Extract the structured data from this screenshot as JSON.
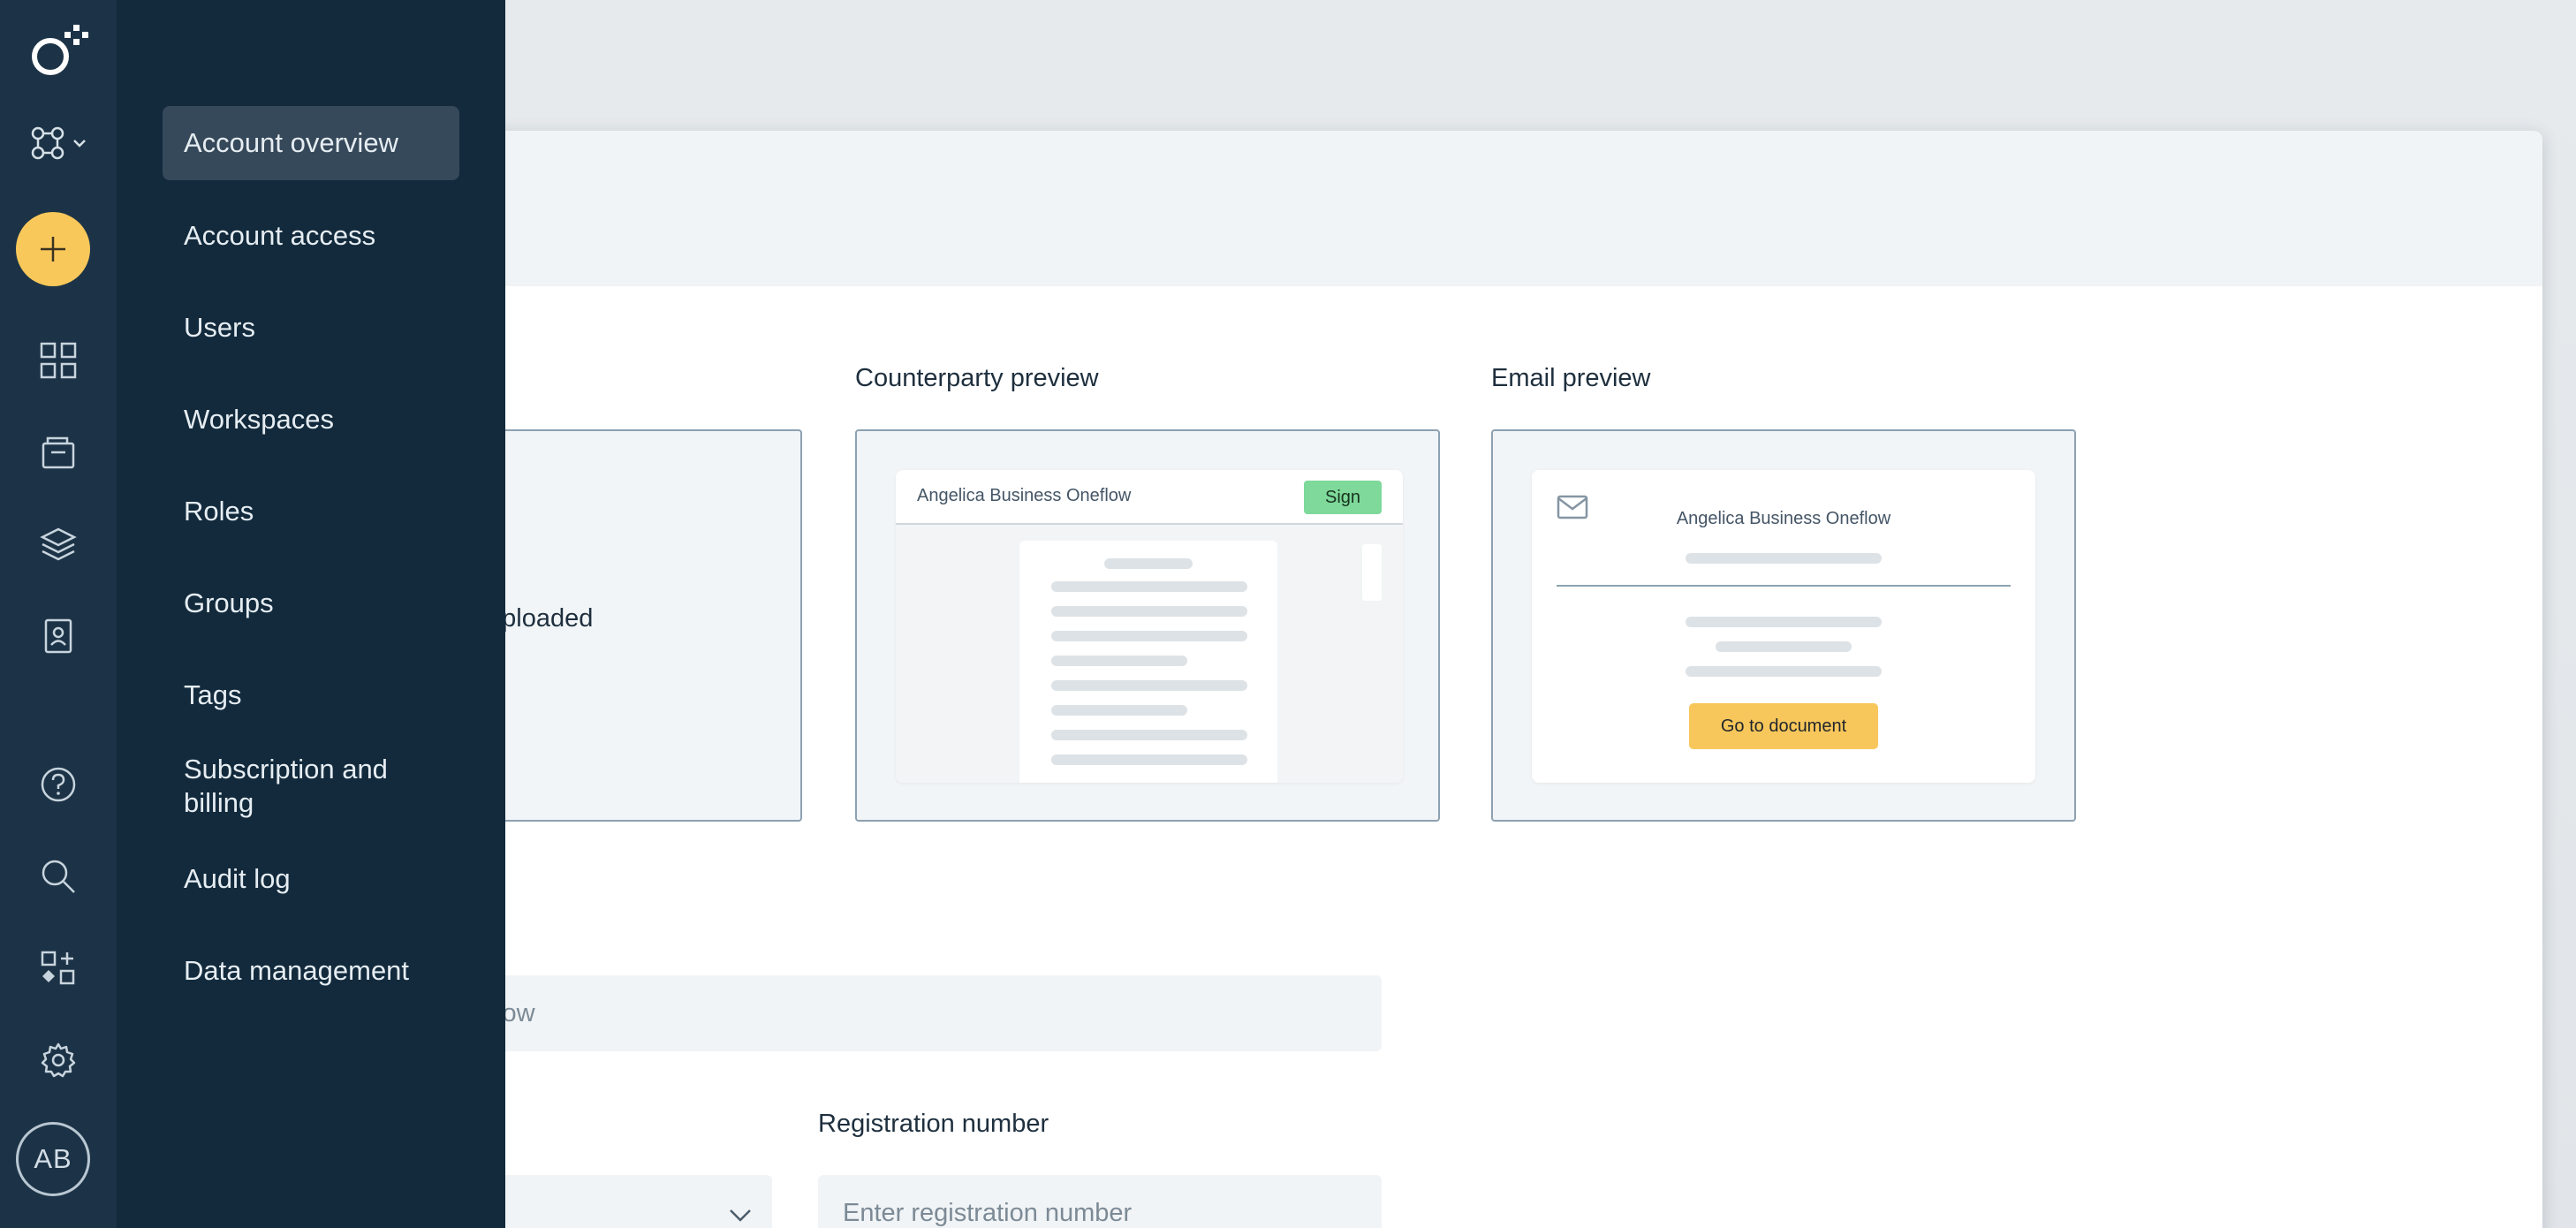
{
  "nav": {
    "items": [
      {
        "label": "Account overview",
        "active": true
      },
      {
        "label": "Account access"
      },
      {
        "label": "Users"
      },
      {
        "label": "Workspaces"
      },
      {
        "label": "Roles"
      },
      {
        "label": "Groups"
      },
      {
        "label": "Tags"
      },
      {
        "label": "Subscription and billing"
      },
      {
        "label": "Audit log"
      },
      {
        "label": "Data management"
      }
    ]
  },
  "rail": {
    "icons": [
      "logo-icon",
      "workspaces-icon",
      "plus-icon",
      "dashboard-icon",
      "documents-icon",
      "templates-icon",
      "address-book-icon",
      "help-icon",
      "search-icon",
      "marketplace-icon",
      "settings-icon"
    ],
    "avatar_initials": "AB",
    "create_color": "#f8c85a"
  },
  "previews": {
    "left_box_text": "uploaded",
    "counterparty": {
      "title": "Counterparty preview",
      "brand": "Angelica Business Oneflow",
      "sign_label": "Sign"
    },
    "email": {
      "title": "Email preview",
      "brand": "Angelica Business Oneflow",
      "button_label": "Go to document"
    }
  },
  "form": {
    "name_value_fragment": "flow",
    "registration_label": "Registration number",
    "registration_placeholder": "Enter registration number"
  },
  "colors": {
    "rail_bg": "#1c3347",
    "subnav_bg": "#122a3c",
    "accent_yellow": "#f8c85a",
    "sign_green": "#7ed99a"
  }
}
